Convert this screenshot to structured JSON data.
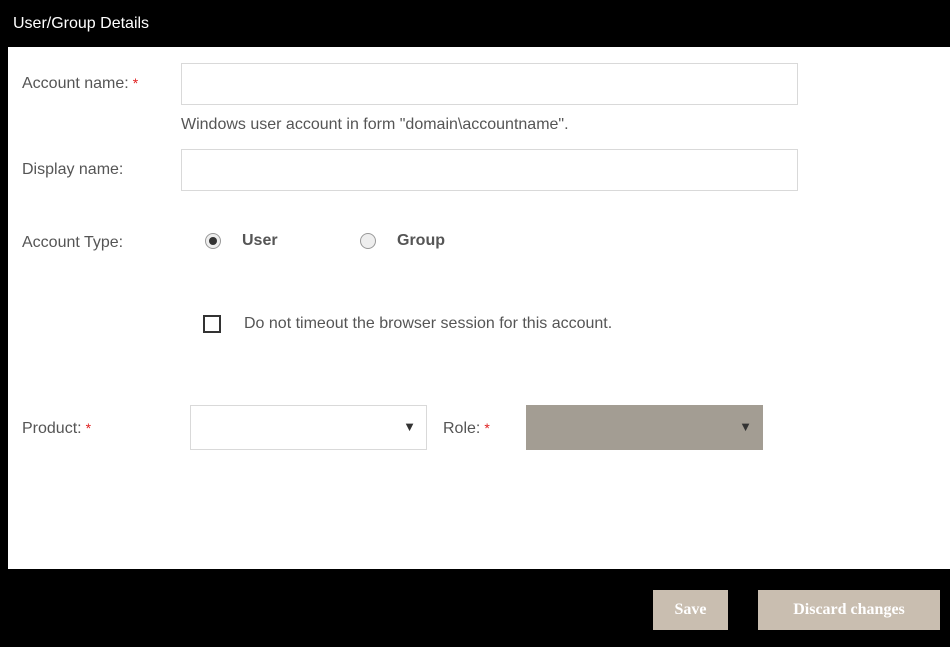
{
  "dialog": {
    "title": "User/Group Details"
  },
  "form": {
    "account_name": {
      "label": "Account name:",
      "required_mark": "*",
      "value": "",
      "hint": "Windows user account in form \"domain\\accountname\"."
    },
    "display_name": {
      "label": "Display name:",
      "value": ""
    },
    "account_type": {
      "label": "Account Type:",
      "options": [
        {
          "label": "User",
          "selected": true
        },
        {
          "label": "Group",
          "selected": false
        }
      ]
    },
    "no_timeout": {
      "label": "Do not timeout the browser session for this account.",
      "checked": false
    },
    "product": {
      "label": "Product:",
      "required_mark": "*",
      "value": ""
    },
    "role": {
      "label": "Role:",
      "required_mark": "*",
      "value": ""
    }
  },
  "footer": {
    "save_label": "Save",
    "discard_label": "Discard changes"
  },
  "icons": {
    "dropdown": "▼"
  },
  "colors": {
    "header_bg": "#000000",
    "required": "#e02020",
    "button_bg": "#c9beb0",
    "role_select_bg": "#a39d93"
  }
}
